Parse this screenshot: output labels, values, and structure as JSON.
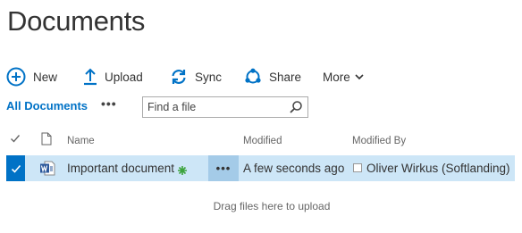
{
  "page": {
    "title": "Documents"
  },
  "commands": {
    "new": "New",
    "upload": "Upload",
    "sync": "Sync",
    "share": "Share",
    "more": "More"
  },
  "views": {
    "current": "All Documents",
    "ellipsis": "•••",
    "search_placeholder": "Find a file"
  },
  "columns": {
    "name": "Name",
    "modified": "Modified",
    "modified_by": "Modified By"
  },
  "rows": [
    {
      "name": "Important document",
      "type_icon": "word-document-icon",
      "is_new": true,
      "modified": "A few seconds ago",
      "modified_by": "Oliver Wirkus (Softlanding)",
      "selected": true,
      "ellipsis": "•••"
    }
  ],
  "dropzone": {
    "text": "Drag files here to upload"
  },
  "colors": {
    "accent": "#0072c6",
    "row_selected": "#cde6f7",
    "new_badge": "#3ca33c"
  }
}
